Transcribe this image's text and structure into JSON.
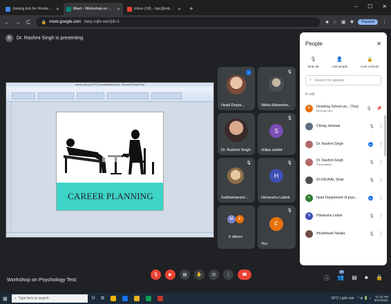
{
  "browser": {
    "tabs": [
      {
        "title": "Joining link for Workshop from",
        "active": false,
        "color": "#4285f4"
      },
      {
        "title": "Meet - Workshop on Psych",
        "active": true,
        "color": "#00897b"
      },
      {
        "title": "Inbox (18) - hpc@mbsa.ac.in - N",
        "active": false,
        "color": "#4285f4"
      }
    ],
    "url_host": "meet.google.com",
    "url_path": "/wey-sqfe-wer/pli=1",
    "paused_label": "Paused"
  },
  "meet": {
    "presenting_text": "Dr. Rashmi Singh is presenting",
    "meeting_name": "Workshop on Psychology Test",
    "slide": {
      "window_title": "career planning PPT [Compatibility Mode] - Microsoft PowerPoint",
      "title": "CAREER PLANNING"
    },
    "tiles": [
      {
        "name": "Head Depar...",
        "kind": "photo"
      },
      {
        "name": "Nikita Maheshw...",
        "kind": "photo"
      },
      {
        "name": "Dr. Rashmi Singh",
        "kind": "photo"
      },
      {
        "name": "shilpa sahlot",
        "kind": "letter",
        "letter": "S",
        "color": "#7b4db6"
      },
      {
        "name": "Subhamansini ...",
        "kind": "photo"
      },
      {
        "name": "Himanshu Ladoti",
        "kind": "letter",
        "letter": "H",
        "color": "#3f51b5"
      },
      {
        "name": "6 others",
        "kind": "group"
      },
      {
        "name": "You",
        "kind": "letter",
        "letter": "F",
        "color": "#e8710a"
      }
    ],
    "controls": [
      "mic-off",
      "camera-off",
      "captions",
      "raise-hand",
      "present",
      "more",
      "end-call"
    ],
    "right_controls": [
      "info",
      "people",
      "chat",
      "activities",
      "host-controls"
    ],
    "people_count": "14"
  },
  "people_panel": {
    "title": "People",
    "close": "✕",
    "actions": [
      {
        "label": "Mute all",
        "icon": "mute-all-icon",
        "glyph": "🎙"
      },
      {
        "label": "Add people",
        "icon": "add-person-icon",
        "glyph": "👤"
      },
      {
        "label": "Host controls",
        "icon": "host-controls-icon",
        "glyph": "🔒"
      }
    ],
    "search_placeholder": "Search for people",
    "in_call_label": "In call",
    "participants": [
      {
        "name": "Finishing School an...",
        "suffix": "(You)",
        "sub": "Meeting host",
        "avatar_letter": "F",
        "color": "#e8710a",
        "status": "mic-off"
      },
      {
        "name": "Chirag Jariwala",
        "sub": "",
        "avatar_letter": "",
        "color": "#5f6c80",
        "status": "mic-off"
      },
      {
        "name": "Dr. Rashmi Singh",
        "sub": "",
        "avatar_letter": "",
        "color": "#b06a6a",
        "status": "speaking"
      },
      {
        "name": "Dr. Rashmi Singh",
        "sub": "Presentation",
        "avatar_letter": "",
        "color": "#b06a6a",
        "status": "mic-off"
      },
      {
        "name": "Dr.KRUNAL Shah",
        "sub": "",
        "avatar_letter": "",
        "color": "#4d4d4d",
        "status": "mic-off"
      },
      {
        "name": "head Department of psyc...",
        "sub": "",
        "avatar_letter": "h",
        "color": "#2e7d32",
        "status": "speaking"
      },
      {
        "name": "Himanshu Ladoti",
        "sub": "",
        "avatar_letter": "H",
        "color": "#3f51b5",
        "status": "mic-off"
      },
      {
        "name": "Hrushikesh Narala",
        "sub": "",
        "avatar_letter": "",
        "color": "#6d4c41",
        "status": "mic-off"
      }
    ]
  },
  "taskbar": {
    "search_placeholder": "Type here to search",
    "weather": "30°C Light rain",
    "time": "11:16 AM",
    "date": "9/14/2021"
  }
}
